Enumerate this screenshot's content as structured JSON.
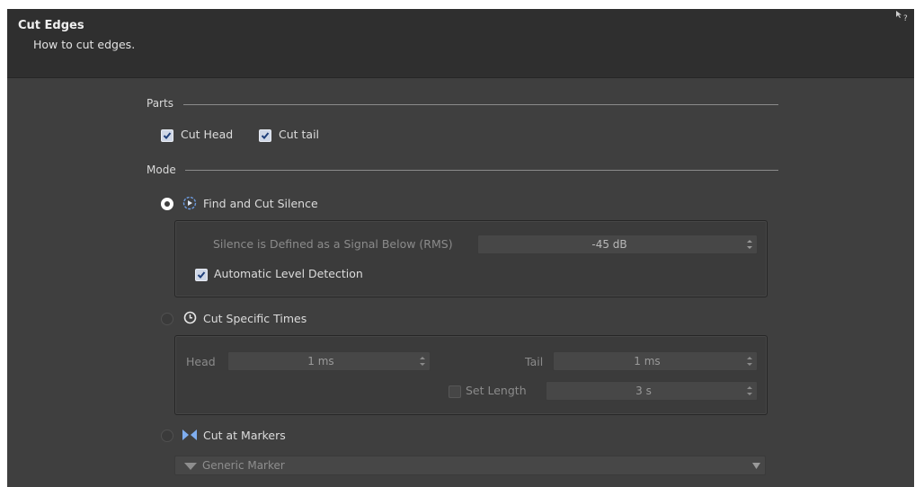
{
  "dialog": {
    "title": "Cut Edges",
    "subtitle": "How to cut edges."
  },
  "parts": {
    "label": "Parts",
    "cut_head": {
      "label": "Cut Head",
      "checked": true
    },
    "cut_tail": {
      "label": "Cut tail",
      "checked": true
    }
  },
  "mode": {
    "label": "Mode",
    "find_silence": {
      "label": "Find and Cut Silence",
      "selected": true,
      "threshold_label": "Silence is Defined as a Signal Below (RMS)",
      "threshold_value": "-45 dB",
      "auto_level": {
        "label": "Automatic Level Detection",
        "checked": true
      }
    },
    "specific_times": {
      "label": "Cut Specific Times",
      "selected": false,
      "head_label": "Head",
      "head_value": "1 ms",
      "tail_label": "Tail",
      "tail_value": "1 ms",
      "set_length": {
        "label": "Set Length",
        "checked": false
      },
      "length_value": "3 s"
    },
    "markers": {
      "label": "Cut at Markers",
      "selected": false,
      "marker_type": "Generic Marker"
    }
  },
  "colors": {
    "background": "#3f3f3f",
    "header": "#2f2f2f",
    "accent": "#5b8bd6"
  }
}
